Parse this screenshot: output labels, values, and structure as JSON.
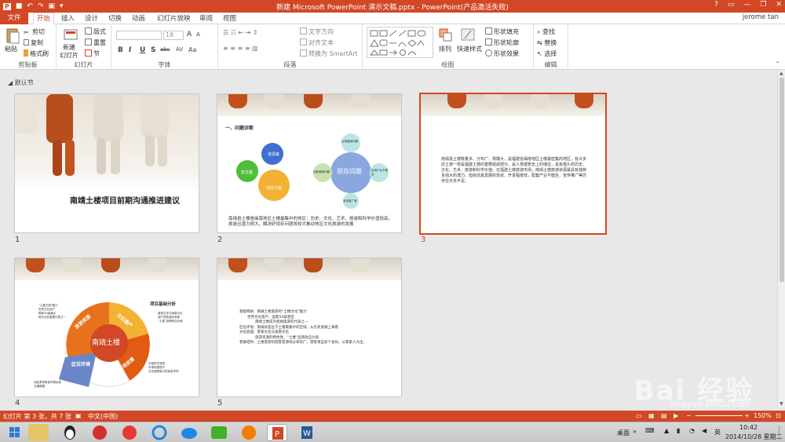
{
  "window": {
    "title": "新建 Microsoft PowerPoint 演示文稿.pptx - PowerPoint(产品激活失败)",
    "controls": [
      "?",
      "▭",
      "—",
      "❐",
      "✕"
    ]
  },
  "tabs": {
    "file": "文件",
    "items": [
      "开始",
      "插入",
      "设计",
      "切换",
      "动画",
      "幻灯片放映",
      "审阅",
      "视图"
    ],
    "user": "jerome tan"
  },
  "ribbon": {
    "clipboard": {
      "label": "剪贴板",
      "paste": "粘贴",
      "cut": "剪切",
      "copy": "复制",
      "painter": "格式刷"
    },
    "slides": {
      "label": "幻灯片",
      "new_slide": "新建",
      "new_slide2": "幻灯片",
      "layout": "版式",
      "reset": "重置",
      "section": "节"
    },
    "font": {
      "label": "字体",
      "size": "18",
      "buttons": [
        "B",
        "I",
        "U",
        "S",
        "abc",
        "AV",
        "Aa",
        "A",
        "A"
      ]
    },
    "paragraph": {
      "label": "段落",
      "text_direction": "文字方向",
      "align_text": "对齐文本",
      "smartart": "转换为 SmartArt"
    },
    "drawing": {
      "label": "绘图",
      "arrange": "排列",
      "quick_styles": "快速样式",
      "fill": "形状填充",
      "outline": "形状轮廓",
      "effects": "形状效果"
    },
    "editing": {
      "label": "编辑",
      "find": "查找",
      "replace": "替换",
      "select": "选择"
    }
  },
  "section": {
    "name": "默认节"
  },
  "slides": [
    {
      "num": "1",
      "title": "南靖土楼项目前期沟通推进建议"
    },
    {
      "num": "2",
      "heading": "一、问题诊断",
      "center": "现存问题",
      "gears": [
        "资源差",
        "定位差",
        "创造力差"
      ],
      "nodes": [
        "区域营销问题",
        "创新营销问题",
        "区域产业不健全",
        "宣传推广差"
      ],
      "text": "南靖县土楼是闽南地区土楼最集中的地区：历史、文化、艺术、旅游和科学价值较高，旅游且潜力很大，解决好现存问题将较大推动地区文化旅游的发展"
    },
    {
      "num": "3",
      "text": "南靖县土楼数量多、分布广、规模大，是福建省闽南地区土楼最密集的地区，有众多的土楼一样是福建土楼的重要组成部分。是人类建筑史上的瑰宝，具有悠久的历史、文化、艺术、旅游和科学价值。在福建土楼旅游市场，南靖土楼旅游资源最具有独特且强大的潜力。但目前其发展的现状、开发程度低，配套产业不健全，宣传推广等仍存在许多不足。"
    },
    {
      "num": "4",
      "center": "南靖土楼",
      "segments": [
        "旅游资源",
        "文化遗产",
        "区位环境",
        "市场前景"
      ],
      "right_title": "项目基础分析",
      "left_list": [
        "“土楼王国”魅力",
        "世界文化遗产",
        "国家5A级景区",
        "闽文化的重要代表之一"
      ],
      "right_list": [
        "客家文化与闽南文化",
        "遗产类旅游的前景",
        "“土楼”品牌效应价值"
      ],
      "right_list2": [
        "中国历史底蕴",
        "市场份额提升",
        "文化强势吸引的旅游市场"
      ],
      "bottom_list": [
        "地处厦漳泉城市群优势",
        "交通便捷"
      ]
    },
    {
      "num": "5",
      "text_lines": [
        "基础特质：南靖土楼旅游的“土楼文化”魅力",
        "世界文化遗产、国家5A级景区",
        "南靖土楼成为南靖旅游的代表之一",
        "区位环境：南靖县是位于土楼最集中的区域，从历史发展上来看",
        "文化底蕴：客家文化与闽南文化",
        "旅游资源的特色性，“土楼”品牌效应价值",
        "客群结构：土楼旅游的游客客源地分布较广，游客来自多个省份，以客家人为主，"
      ]
    }
  ],
  "status": {
    "slide_info": "幻灯片 第 3 张，共 7 张",
    "lang": "中文(中国)",
    "zoom": "150%"
  },
  "taskbar": {
    "desktop": "桌面",
    "ime": "英",
    "time": "10:42",
    "date": "2014/10/28 星期二"
  },
  "watermark": {
    "brand": "Bai 经验",
    "url": "jingyan.baidu.com"
  }
}
